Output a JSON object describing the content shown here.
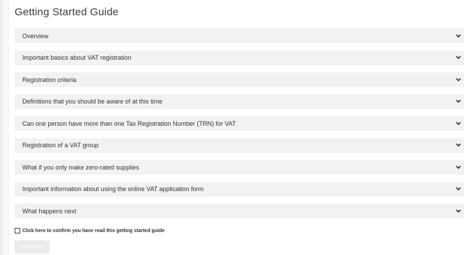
{
  "page": {
    "title": "Getting Started Guide"
  },
  "accordion": {
    "items": [
      {
        "label": "Overview"
      },
      {
        "label": "Important basics about VAT registration"
      },
      {
        "label": "Registration criteria"
      },
      {
        "label": "Definitions that you should be aware of at this time"
      },
      {
        "label": "Can one person have more than one Tax Registration Number (TRN) for VAT"
      },
      {
        "label": "Registration of a VAT group"
      },
      {
        "label": "What if you only make zero-rated supplies"
      },
      {
        "label": "Important information about using the online VAT application form"
      },
      {
        "label": "What happens next"
      }
    ],
    "icon": "chevron-down-icon"
  },
  "confirm": {
    "label": "Click here to confirm you have read this getting started guide",
    "checked": false
  },
  "proceed": {
    "label": "Proceed",
    "enabled": false
  },
  "colors": {
    "item_background": "#f2f2f2",
    "text": "#333333",
    "button_disabled": "#ececec"
  }
}
